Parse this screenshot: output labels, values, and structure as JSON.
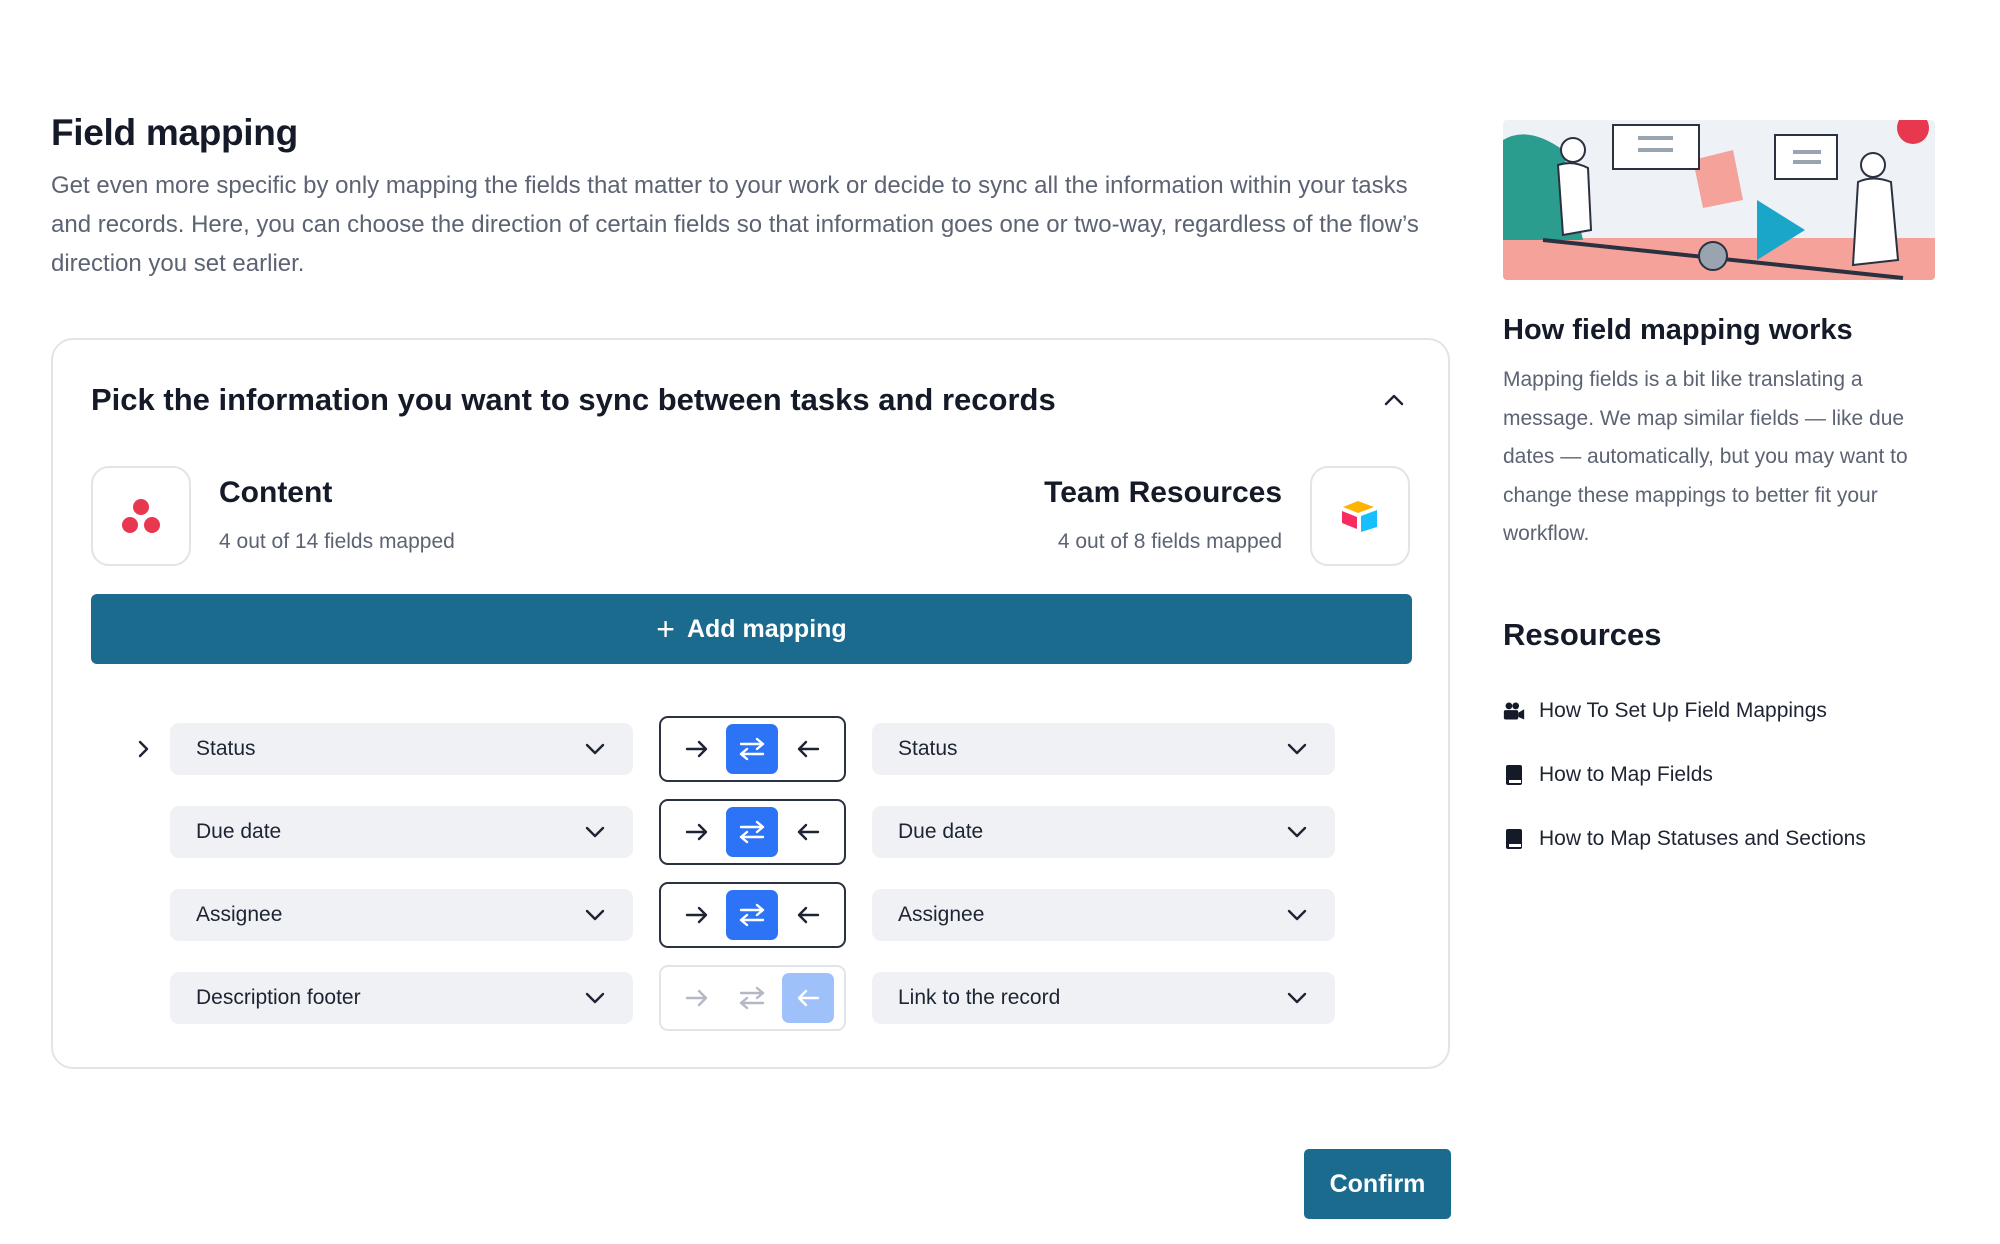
{
  "page": {
    "title": "Field mapping",
    "description": "Get even more specific by only mapping the fields that matter to your work or decide to sync all the information within your tasks and records. Here, you can choose the direction of certain fields so that information goes one or two-way, regardless of the flow’s direction you set earlier."
  },
  "card": {
    "title": "Pick the information you want to sync between tasks and records",
    "left_app": {
      "name": "Content",
      "subtitle": "4 out of 14 fields mapped",
      "icon": "asana-logo-icon"
    },
    "right_app": {
      "name": "Team Resources",
      "subtitle": "4 out of 8 fields mapped",
      "icon": "airtable-logo-icon"
    },
    "add_mapping_label": "Add mapping"
  },
  "mappings": [
    {
      "left": "Status",
      "right": "Status",
      "direction": "two-way"
    },
    {
      "left": "Due date",
      "right": "Due date",
      "direction": "two-way"
    },
    {
      "left": "Assignee",
      "right": "Assignee",
      "direction": "two-way"
    },
    {
      "left": "Description footer",
      "right": "Link to the record",
      "direction": "right-to-left",
      "locked": true
    }
  ],
  "confirm_label": "Confirm",
  "sidebar": {
    "title": "How field mapping works",
    "text": "Mapping fields is a bit like translating a message. We map similar fields — like due dates — automatically, but you may want to change these mappings to better fit your workflow.",
    "resources_title": "Resources",
    "resources": [
      {
        "label": "How To Set Up Field Mappings",
        "icon": "video-camera-icon"
      },
      {
        "label": "How to Map Fields",
        "icon": "book-icon"
      },
      {
        "label": "How to Map Statuses and Sections",
        "icon": "book-icon"
      }
    ]
  },
  "colors": {
    "primary": "#1b6b8f",
    "direction_active": "#2d73f5",
    "direction_inactive": "#9fc1f9",
    "select_bg": "#eff1f4"
  }
}
